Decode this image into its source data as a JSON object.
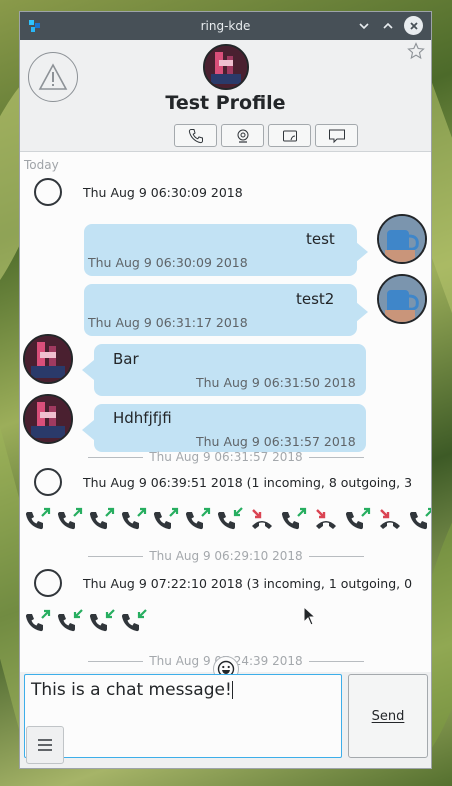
{
  "window": {
    "title": "ring-kde"
  },
  "header": {
    "profile_name": "Test Profile"
  },
  "timeline": {
    "today_label": "Today",
    "events": [
      {
        "type": "call-group",
        "timestamp": "Thu Aug 9 06:30:09 2018"
      }
    ],
    "messages": [
      {
        "direction": "outgoing",
        "text": "test",
        "time": "Thu Aug 9 06:30:09 2018"
      },
      {
        "direction": "outgoing",
        "text": "test2",
        "time": "Thu Aug 9 06:31:17 2018"
      },
      {
        "direction": "incoming",
        "text": "Bar",
        "time": "Thu Aug 9 06:31:50 2018"
      },
      {
        "direction": "incoming",
        "text": "Hdhfjfjfi",
        "time": "Thu Aug 9 06:31:57 2018"
      }
    ],
    "separator1": "Thu Aug 9 06:31:57 2018",
    "group1": {
      "summary": "Thu Aug 9 06:39:51 2018 (1 incoming, 8 outgoing, 3",
      "calls": [
        "outgoing",
        "outgoing",
        "outgoing",
        "outgoing",
        "outgoing",
        "outgoing",
        "incoming",
        "missed",
        "outgoing",
        "missed",
        "outgoing",
        "missed",
        "outgoing"
      ]
    },
    "separator2": "Thu Aug 9 06:29:10 2018",
    "group2": {
      "summary": "Thu Aug 9 07:22:10 2018 (3 incoming, 1 outgoing, 0",
      "calls": [
        "outgoing",
        "incoming",
        "incoming",
        "incoming"
      ]
    },
    "separator3": "Thu Aug 9 07:24:39 2018"
  },
  "composer": {
    "text": "This is a chat message!",
    "send_label": "Send"
  },
  "colors": {
    "accent": "#3daee9",
    "bubble": "#c2e2f4",
    "missed": "#da4453",
    "ok": "#27ae60"
  }
}
